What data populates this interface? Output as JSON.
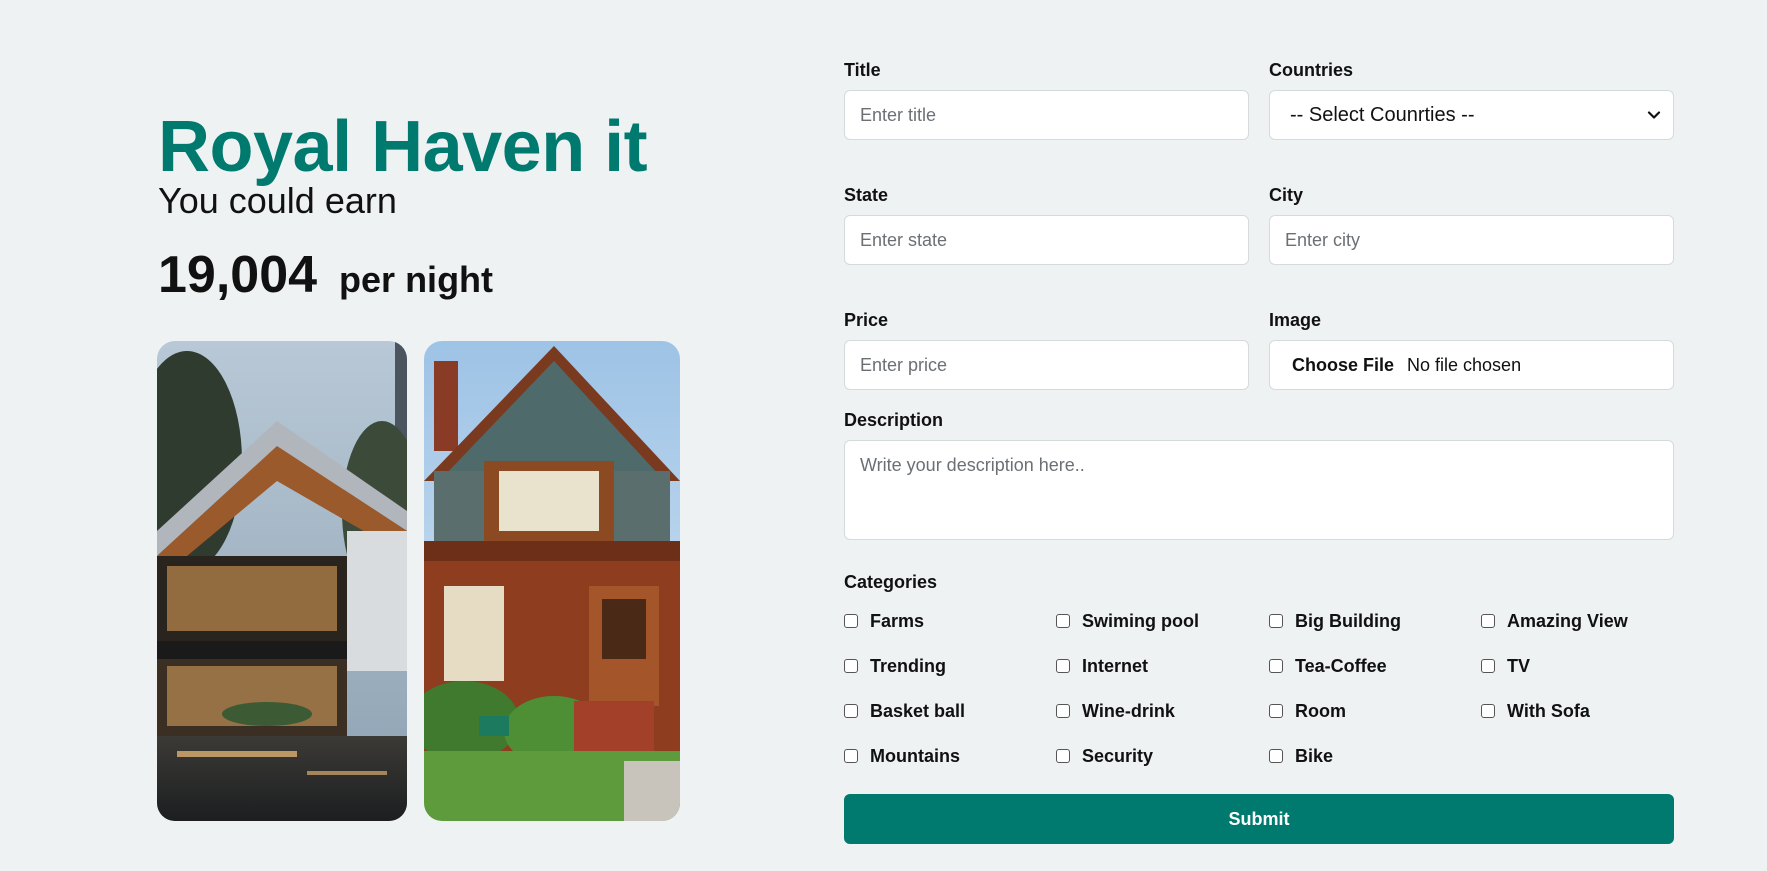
{
  "hero": {
    "title": "Royal Haven it",
    "subtitle": "You could earn",
    "amount": "19,004",
    "unit": "per night"
  },
  "form": {
    "title": {
      "label": "Title",
      "placeholder": "Enter title"
    },
    "countries": {
      "label": "Countries",
      "selected": "-- Select Counrties --"
    },
    "state": {
      "label": "State",
      "placeholder": "Enter state"
    },
    "city": {
      "label": "City",
      "placeholder": "Enter city"
    },
    "price": {
      "label": "Price",
      "placeholder": "Enter price"
    },
    "image": {
      "label": "Image",
      "button": "Choose File",
      "status": "No file chosen"
    },
    "description": {
      "label": "Description",
      "placeholder": "Write your description here.."
    },
    "categories_label": "Categories",
    "categories": [
      "Farms",
      "Swiming pool",
      "Big Building",
      "Amazing View",
      "Trending",
      "Internet",
      "Tea-Coffee",
      "TV",
      "Basket ball",
      "Wine-drink",
      "Room",
      "With Sofa",
      "Mountains",
      "Security",
      "Bike"
    ],
    "submit_label": "Submit"
  },
  "colors": {
    "accent": "#00796e",
    "background": "#eff2f3"
  },
  "icons": {
    "select_chevron": "chevron-down-icon"
  }
}
